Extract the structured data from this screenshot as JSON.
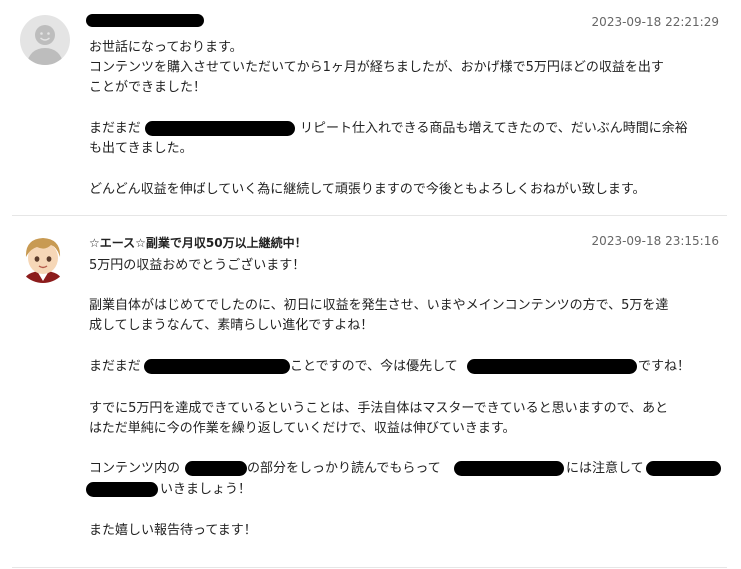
{
  "comments": [
    {
      "timestamp": "2023-09-18 22:21:29",
      "lines": [
        "お世話になっております。",
        "コンテンツを購入させていただいてから1ヶ月が経ちましたが、おかげ様で5万円ほどの収益を出す",
        "ことができました！",
        "まだまだ",
        "リピート仕入れできる商品も増えてきたので、だいぶん時間に余裕",
        "も出てきました。",
        "どんどん収益を伸ばしていく為に継続して頑張りますので今後ともよろしくおねがい致します。"
      ]
    },
    {
      "name": "☆エース☆副業で月収50万以上継続中！",
      "timestamp": "2023-09-18 23:15:16",
      "lines": [
        "5万円の収益おめでとうございます！",
        "副業自体がはじめてでしたのに、初日に収益を発生させ、いまやメインコンテンツの方で、5万を達",
        "成してしまうなんて、素晴らしい進化ですよね！",
        "まだまだ",
        "ことですので、今は優先して",
        "ですね！",
        "すでに5万円を達成できているということは、手法自体はマスターできていると思いますので、あと",
        "はただ単純に今の作業を繰り返していくだけで、収益は伸びていきます。",
        "コンテンツ内の",
        "の部分をしっかり読んでもらって",
        "には注意して",
        "いきましょう！",
        "また嬉しい報告待ってます！"
      ]
    }
  ]
}
